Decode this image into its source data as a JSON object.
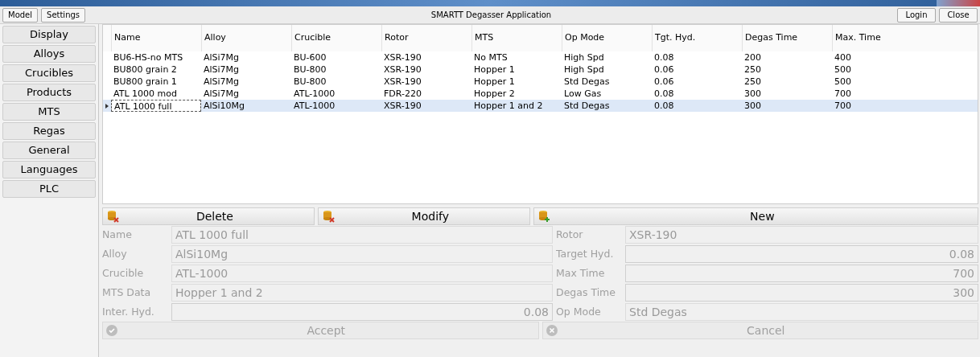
{
  "window": {
    "title": "SMARTT Degasser Application"
  },
  "toolbar_left": [
    "Model",
    "Settings"
  ],
  "toolbar_right": [
    "Login",
    "Close"
  ],
  "sidebar": {
    "items": [
      {
        "label": "Display"
      },
      {
        "label": "Alloys"
      },
      {
        "label": "Crucibles"
      },
      {
        "label": "Products"
      },
      {
        "label": "MTS"
      },
      {
        "label": "Regas"
      },
      {
        "label": "General"
      },
      {
        "label": "Languages"
      },
      {
        "label": "PLC"
      }
    ]
  },
  "table": {
    "columns": [
      "Name",
      "Alloy",
      "Crucible",
      "Rotor",
      "MTS",
      "Op Mode",
      "Tgt. Hyd.",
      "Degas Time",
      "Max. Time"
    ],
    "rows": [
      {
        "selected": false,
        "cells": [
          "BU6-HS-no MTS",
          "AlSi7Mg",
          "BU-600",
          "XSR-190",
          "No MTS",
          "High Spd",
          "0.08",
          "200",
          "400"
        ]
      },
      {
        "selected": false,
        "cells": [
          "BU800 grain 2",
          "AlSi7Mg",
          "BU-800",
          "XSR-190",
          "Hopper 1",
          "High Spd",
          "0.06",
          "250",
          "500"
        ]
      },
      {
        "selected": false,
        "cells": [
          "BU800 grain 1",
          "AlSi7Mg",
          "BU-800",
          "XSR-190",
          "Hopper 1",
          "Std Degas",
          "0.06",
          "250",
          "500"
        ]
      },
      {
        "selected": false,
        "cells": [
          "ATL 1000 mod",
          "AlSi7Mg",
          "ATL-1000",
          "FDR-220",
          "Hopper 2",
          "Low Gas",
          "0.08",
          "300",
          "700"
        ]
      },
      {
        "selected": true,
        "cells": [
          "ATL 1000 full",
          "AlSi10Mg",
          "ATL-1000",
          "XSR-190",
          "Hopper 1 and 2",
          "Std Degas",
          "0.08",
          "300",
          "700"
        ]
      }
    ]
  },
  "actions": [
    {
      "label": "Delete",
      "kind": "delete"
    },
    {
      "label": "Modify",
      "kind": "delete"
    },
    {
      "label": "New",
      "kind": "add"
    }
  ],
  "form_left": [
    {
      "label": "Name",
      "value": "ATL 1000 full",
      "kind": "text"
    },
    {
      "label": "Alloy",
      "value": "AlSi10Mg",
      "kind": "combo"
    },
    {
      "label": "Crucible",
      "value": "ATL-1000",
      "kind": "combo"
    },
    {
      "label": "MTS Data",
      "value": "Hopper 1 and 2",
      "kind": "combo"
    },
    {
      "label": "Inter. Hyd.",
      "value": "0.08",
      "kind": "spin"
    }
  ],
  "form_right": [
    {
      "label": "Rotor",
      "value": "XSR-190",
      "kind": "combo"
    },
    {
      "label": "Target Hyd.",
      "value": "0.08",
      "kind": "spin"
    },
    {
      "label": "Max Time",
      "value": "700",
      "kind": "spin"
    },
    {
      "label": "Degas Time",
      "value": "300",
      "kind": "spin"
    },
    {
      "label": "Op Mode",
      "value": "Std Degas",
      "kind": "combo"
    }
  ],
  "confirm": [
    {
      "label": "Accept",
      "kind": "accept"
    },
    {
      "label": "Cancel",
      "kind": "cancel"
    }
  ]
}
